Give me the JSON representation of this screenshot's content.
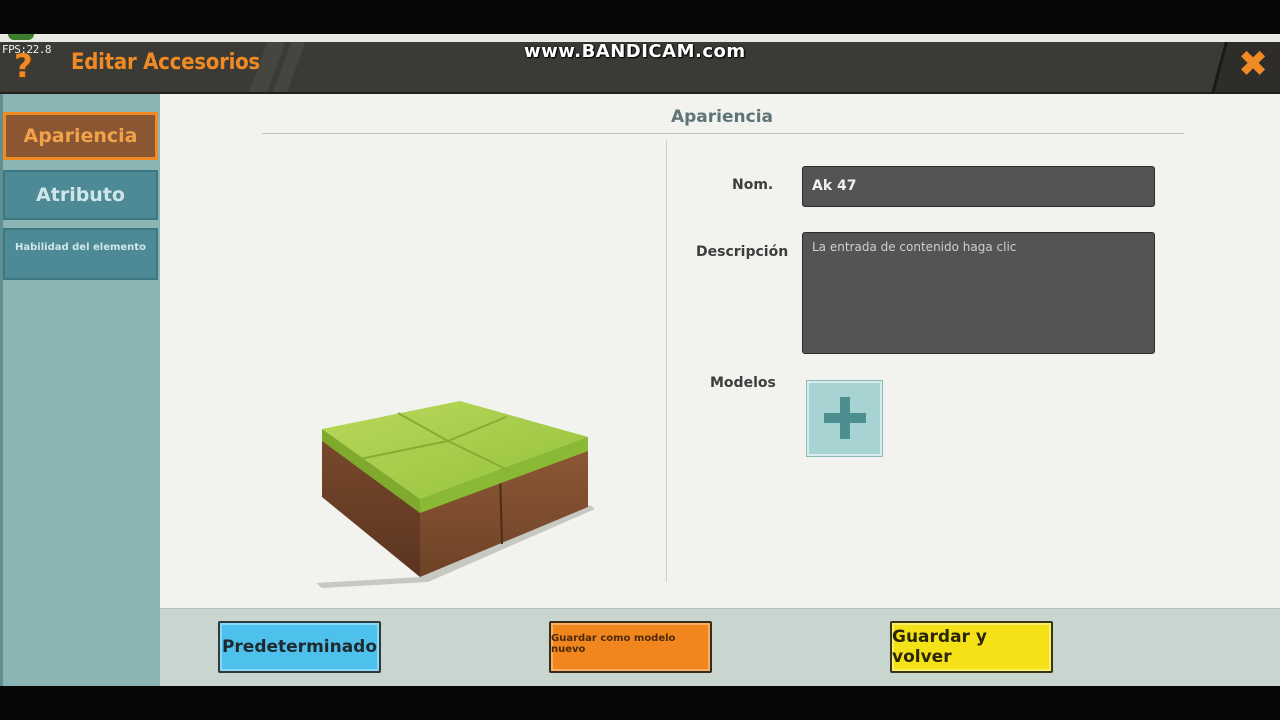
{
  "overlay": {
    "fps": "FPS:22.8",
    "watermark": "www.BANDICAM.com"
  },
  "header": {
    "title": "Editar Accesorios",
    "help_icon": "question-mark-icon",
    "close_icon": "close-x-icon",
    "help_glyph": "?",
    "close_glyph": "✖"
  },
  "sidebar": {
    "items": [
      {
        "label": "Apariencia",
        "active": true
      },
      {
        "label": "Atributo",
        "active": false
      },
      {
        "label": "Habilidad del elemento",
        "active": false
      }
    ]
  },
  "main": {
    "section_title": "Apariencia",
    "name_label": "Nom.",
    "name_value": "Ak 47",
    "description_label": "Descripción",
    "description_value": "La entrada de contenido haga clic",
    "models_label": "Modelos",
    "add_model_icon": "plus-icon",
    "preview": "grass-block-preview"
  },
  "buttons": {
    "default": "Predeterminado",
    "save_as_new": "Guardar como modelo nuevo",
    "save_and_back": "Guardar y volver"
  },
  "colors": {
    "accent_orange": "#f08a24",
    "header_bg": "#3b3a35",
    "sidebar_bg": "#8bb5b4",
    "tab_active_bg": "#8b5632",
    "tab_bg": "#4e8a96",
    "btn_blue": "#4ec0ec",
    "btn_orange": "#f2861e",
    "btn_yellow": "#f5e117"
  }
}
